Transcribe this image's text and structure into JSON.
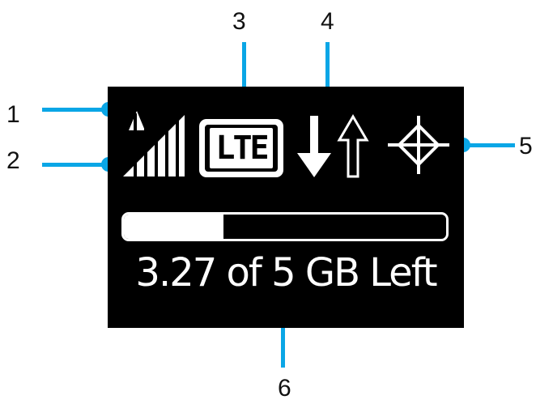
{
  "callouts": {
    "c1": "1",
    "c2": "2",
    "c3": "3",
    "c4": "4",
    "c5": "5",
    "c6": "6"
  },
  "display": {
    "network_badge": "LTE",
    "data_status": "3.27 of 5 GB Left",
    "usage_bar_remaining_fraction": 0.31
  },
  "icons": [
    "roaming-triangle-icon",
    "signal-strength-icon",
    "lte-badge-icon",
    "download-arrow-icon",
    "upload-arrow-icon",
    "gps-crosshair-icon"
  ],
  "colors": {
    "callout_accent": "#0aa6e6",
    "screen_background": "#000000",
    "screen_foreground": "#ffffff",
    "text": "#111111"
  }
}
